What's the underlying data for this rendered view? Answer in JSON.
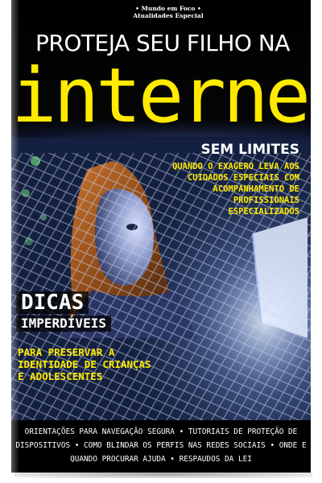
{
  "magazine": {
    "badge_line1": "• Mundo em Foco •",
    "badge_line2": "Atualidades Especial"
  },
  "headline": {
    "line1": "PROTEJA SEU FILHO NA",
    "line2": "internet"
  },
  "feature": {
    "title": "SEM LIMITES",
    "description": "QUANDO O EXAGERO LEVA AOS CUIDADOS ESPECIAIS COM ACOMPANHAMENTO DE PROFISSIONAIS ESPECIALIZADOS"
  },
  "tips": {
    "title": "DICAS",
    "subtitle": "IMPERDÍVEIS",
    "description": "PARA PRESERVAR A IDENTIDADE DE CRIANÇAS E ADOLESCENTES"
  },
  "footer": {
    "topics": "ORIENTAÇÕES PARA NAVEGAÇÃO SEGURA • TUTORIAIS DE PROTEÇÃO DE DISPOSITIVOS • COMO BLINDAR OS PERFIS NAS REDES SOCIAIS • ONDE E QUANDO PROCURAR AJUDA • RESPAUDOS DA LEI"
  },
  "colors": {
    "accent_yellow": "#ffea00",
    "background_dark": "#000000",
    "scene_blue": "#1f2c55"
  }
}
